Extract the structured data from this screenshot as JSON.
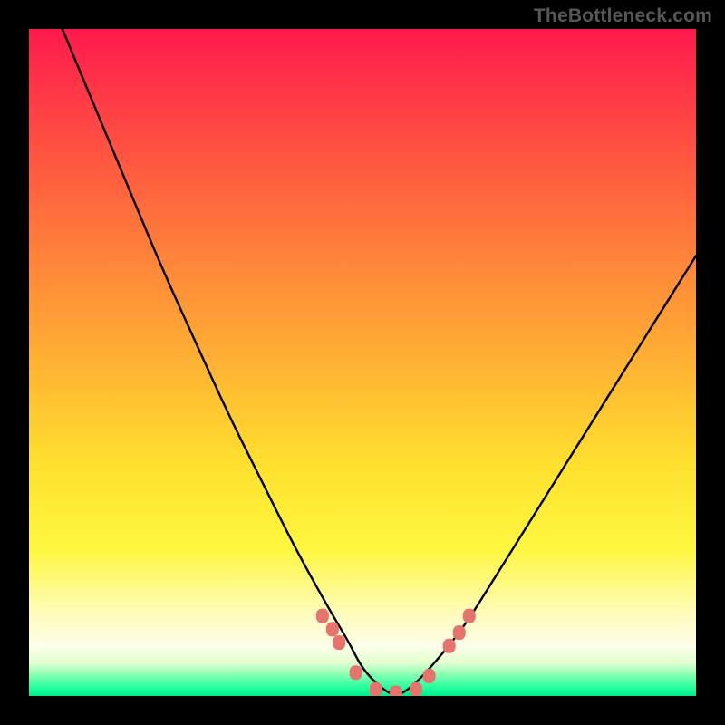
{
  "watermark": "TheBottleneck.com",
  "chart_data": {
    "type": "line",
    "title": "",
    "xlabel": "",
    "ylabel": "",
    "xlim": [
      0,
      100
    ],
    "ylim": [
      0,
      100
    ],
    "series": [
      {
        "name": "bottleneck-curve",
        "x": [
          5,
          10,
          15,
          20,
          25,
          30,
          35,
          40,
          45,
          48,
          50,
          53,
          55,
          57,
          60,
          65,
          70,
          75,
          80,
          85,
          90,
          95,
          100
        ],
        "y": [
          100,
          88,
          76,
          64,
          53,
          42,
          32,
          22,
          13,
          8,
          4,
          1,
          0,
          1,
          4,
          10,
          18,
          26,
          34,
          42,
          50,
          58,
          66
        ]
      }
    ],
    "markers": {
      "name": "highlight-dots",
      "x": [
        44,
        45.5,
        46.5,
        49,
        52,
        55,
        58,
        60,
        63,
        64.5,
        66
      ],
      "y": [
        12,
        10,
        8,
        3.5,
        1,
        0.5,
        1,
        3,
        7.5,
        9.5,
        12
      ]
    }
  }
}
